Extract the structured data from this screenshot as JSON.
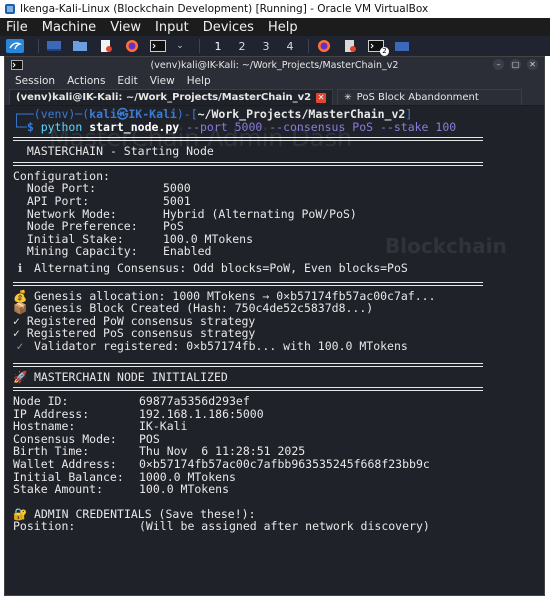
{
  "vbox": {
    "title": "Ikenga-Kali-Linux (Blockchain Development) [Running] - Oracle VM VirtualBox",
    "menu": [
      "File",
      "Machine",
      "View",
      "Input",
      "Devices",
      "Help"
    ]
  },
  "panel": {
    "workspaces": [
      "1",
      "2",
      "3",
      "4"
    ],
    "badge": "2"
  },
  "terminal": {
    "window_title": "(venv)kali@IK-Kali: ~/Work_Projects/MasterChain_v2",
    "menu": [
      "Session",
      "Actions",
      "Edit",
      "View",
      "Help"
    ],
    "tabs": [
      {
        "label": "(venv)kali@IK-Kali: ~/Work_Projects/MasterChain_v2",
        "close": "✕"
      },
      {
        "label": "PoS Block Abandonment",
        "glyph": "✳"
      }
    ],
    "prompt": {
      "line1_prefix": "┌──(venv)─(",
      "user": "kali",
      "skull": "㉿",
      "host": "IK-Kali",
      "line1_mid": ")-[",
      "path": "~/Work_Projects/MasterChain_v2",
      "line1_end": "]",
      "line2_prefix": "└─$ ",
      "cmd": "python",
      "file": "start_node.py",
      "args": "--port 5000 --consensus PoS --stake 100"
    },
    "starting_header": "MASTERCHAIN - Starting Node",
    "config_title": "Configuration:",
    "config": [
      {
        "key": "  Node Port:",
        "value": "5000"
      },
      {
        "key": "  API Port:",
        "value": "5001"
      },
      {
        "key": "  Network Mode:",
        "value": "Hybrid (Alternating PoW/PoS)"
      },
      {
        "key": "  Node Preference:",
        "value": "PoS"
      },
      {
        "key": "  Initial Stake:",
        "value": "100.0 MTokens"
      },
      {
        "key": "  Mining Capacity:",
        "value": "Enabled"
      }
    ],
    "alternating": "Alternating Consensus: Odd blocks=PoW, Even blocks=PoS",
    "genesis_alloc": "Genesis allocation: 1000 MTokens → 0×b57174fb57ac00c7af...",
    "genesis_block": "Genesis Block Created (Hash: 750c4de52c5837d8...)",
    "registered_pow": "Registered PoW consensus strategy",
    "registered_pos": "Registered PoS consensus strategy",
    "validator": "Validator registered: 0×b57174fb... with 100.0 MTokens",
    "initialized_header": "MASTERCHAIN NODE INITIALIZED",
    "node_info": [
      {
        "key": "Node ID:",
        "value": "69877a5356d293ef"
      },
      {
        "key": "IP Address:",
        "value": "192.168.1.186:5000"
      },
      {
        "key": "Hostname:",
        "value": "IK-Kali"
      },
      {
        "key": "Consensus Mode:",
        "value": "POS"
      },
      {
        "key": "Birth Time:",
        "value": "Thu Nov  6 11:28:51 2025"
      },
      {
        "key": "Wallet Address:",
        "value": "0×b57174fb57ac00c7afbb963535245f668f23bb9c"
      },
      {
        "key": "Initial Balance:",
        "value": "1000.0 MTokens"
      },
      {
        "key": "Stake Amount:",
        "value": "100.0 MTokens"
      }
    ],
    "admin_header": "ADMIN CREDENTIALS (Save these!):",
    "position_key": "Position:",
    "position_value": "(Will be assigned after network discovery)",
    "icons": {
      "info": "ℹ",
      "money": "💰",
      "package": "📦",
      "check": "✓",
      "rocket": "🚀",
      "lock": "🔐"
    }
  },
  "colors": {
    "terminal_bg": "#20222a",
    "prompt_blue": "#3a7bd5",
    "arg_purple": "#8a7cd8",
    "cmd_cyan": "#5fd7ff"
  }
}
